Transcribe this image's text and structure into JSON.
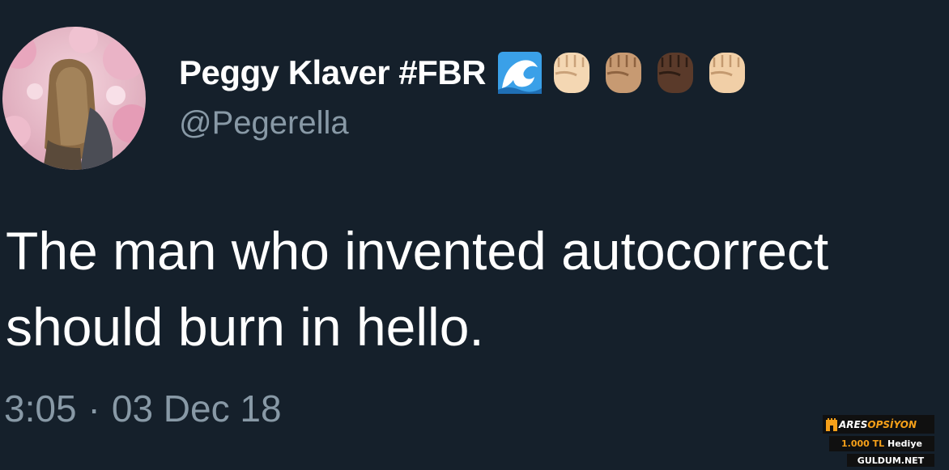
{
  "tweet": {
    "author": {
      "display_name": "Peggy Klaver #FBR",
      "handle": "@Pegerella",
      "name_emojis": [
        "water-wave-icon",
        "raised-fist-light-icon",
        "raised-fist-medium-icon",
        "raised-fist-dark-icon",
        "raised-fist-light-icon"
      ],
      "avatar": "avatar-woman-cherry-blossoms"
    },
    "text": "The man who invented autocorrect\nshould burn in hello.",
    "time": "3:05",
    "separator": "·",
    "date": "03 Dec 18"
  },
  "watermark": {
    "brand_white": "ARES",
    "brand_orange": "OPSİYON",
    "offer_amount": "1.000 TL",
    "offer_text": "Hediye",
    "site": "GULDUM.NET"
  },
  "colors": {
    "background": "#15202b",
    "primary_text": "#ffffff",
    "secondary_text": "#8899a6",
    "watermark_accent": "#f6a019"
  }
}
